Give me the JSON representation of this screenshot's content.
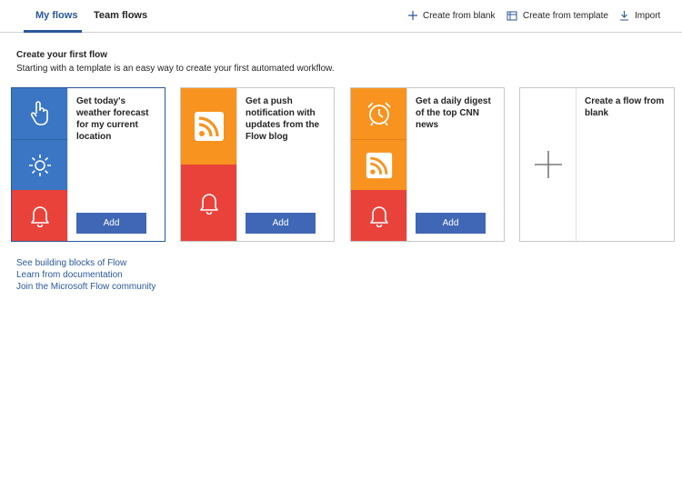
{
  "header": {
    "tabs": [
      {
        "label": "My flows",
        "active": true
      },
      {
        "label": "Team flows",
        "active": false
      }
    ],
    "commands": {
      "create_blank": "Create from blank",
      "create_template": "Create from template",
      "import": "Import"
    }
  },
  "main": {
    "title": "Create your first flow",
    "subtitle": "Starting with a template is an easy way to create your first automated workflow.",
    "cards": [
      {
        "text": "Get today's weather forecast for my current location",
        "button": "Add",
        "icons": [
          "touch-icon",
          "sun-icon",
          "bell-icon"
        ]
      },
      {
        "text": "Get a push notification with updates from the Flow blog",
        "button": "Add",
        "icons": [
          "rss-icon",
          "bell-icon"
        ]
      },
      {
        "text": "Get a daily digest of the top CNN news",
        "button": "Add",
        "icons": [
          "alarm-clock-icon",
          "rss-icon",
          "bell-icon"
        ]
      },
      {
        "text": "Create a flow from blank",
        "icons": [
          "plus-icon"
        ]
      }
    ],
    "links": [
      "See building blocks of Flow",
      "Learn from documentation",
      "Join the Microsoft Flow community"
    ]
  },
  "colors": {
    "accent": "#2b579a",
    "button": "#4067b5",
    "tile_blue": "#3a76c4",
    "tile_orange": "#f7931e",
    "tile_red": "#e8423a"
  }
}
